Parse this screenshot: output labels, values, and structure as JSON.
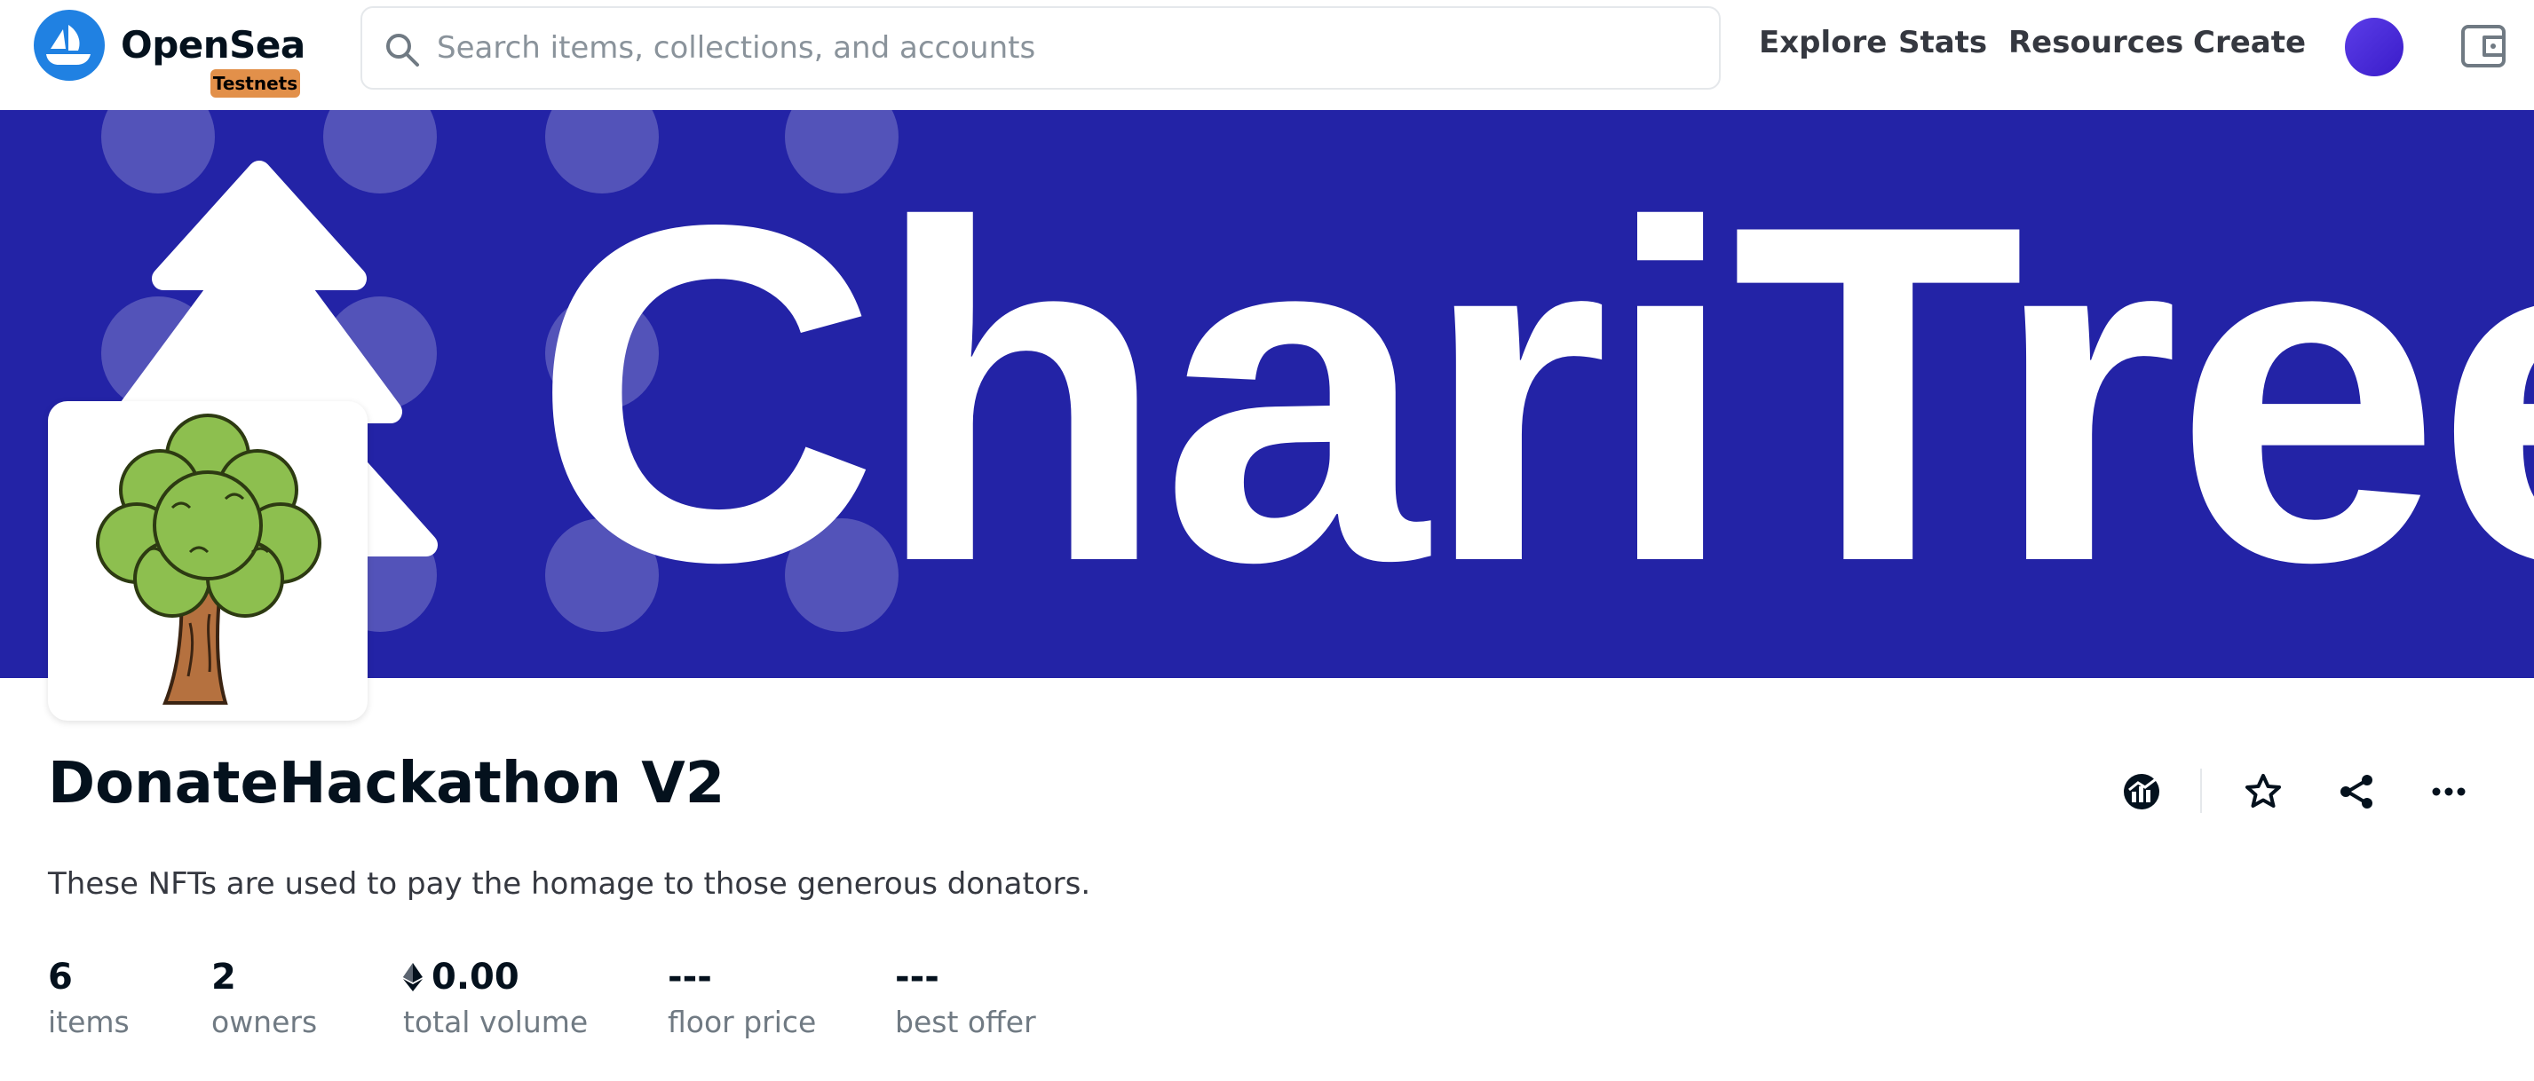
{
  "nav": {
    "brand": "OpenSea",
    "badge": "Testnets",
    "search_placeholder": "Search items, collections, and accounts",
    "links": [
      "Explore",
      "Stats",
      "Resources",
      "Create"
    ],
    "icons": {
      "logo": "opensea-logo-icon",
      "search": "search-icon",
      "profile": "avatar",
      "wallet": "wallet-icon"
    }
  },
  "banner": {
    "text": "ChariTree",
    "background": "#2323a6"
  },
  "collection": {
    "title": "DonateHackathon V2",
    "description": "These NFTs are used to pay the homage to those generous donators.",
    "actions": [
      "activity-chart-icon",
      "star-icon",
      "share-icon",
      "more-icon"
    ]
  },
  "stats": [
    {
      "value": "6",
      "label": "items"
    },
    {
      "value": "2",
      "label": "owners"
    },
    {
      "value": "0.00",
      "label": "total volume",
      "icon": "ethereum-icon"
    },
    {
      "value": "---",
      "label": "floor price"
    },
    {
      "value": "---",
      "label": "best offer"
    }
  ],
  "colors": {
    "accent": "#2081e2",
    "badge": "#e2904a",
    "banner": "#2323a6"
  }
}
